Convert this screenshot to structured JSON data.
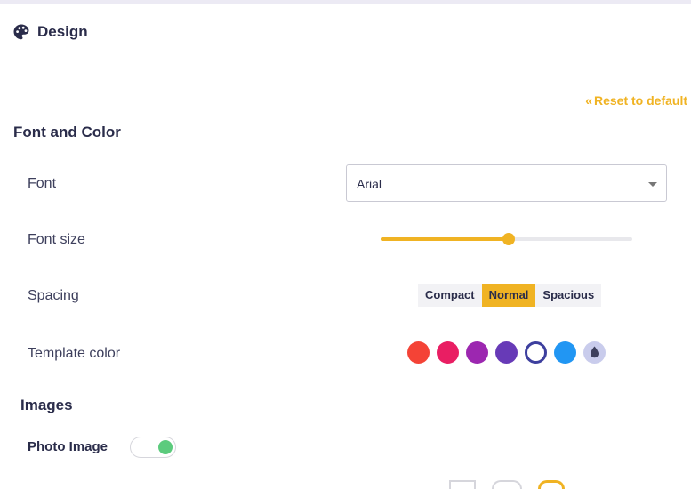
{
  "header": {
    "title": "Design",
    "icon": "palette-icon"
  },
  "reset": {
    "label": "Reset to default",
    "icon": "double-chevron-left-icon",
    "color": "#f0b323"
  },
  "font_and_color": {
    "title": "Font and Color",
    "font": {
      "label": "Font",
      "value": "Arial"
    },
    "font_size": {
      "label": "Font size",
      "value_fraction": 0.51
    },
    "spacing": {
      "label": "Spacing",
      "options": [
        "Compact",
        "Normal",
        "Spacious"
      ],
      "selected": "Normal"
    },
    "template_color": {
      "label": "Template color",
      "colors": [
        "#f44336",
        "#e91e63",
        "#9c27b0",
        "#673ab7",
        "#ffffff",
        "#2196f3"
      ],
      "selected_index": 4,
      "picker_icon": "color-drop-icon"
    }
  },
  "images": {
    "title": "Images",
    "photo_image": {
      "label": "Photo Image",
      "enabled": true,
      "on_color": "#5ccb7d"
    }
  },
  "colors": {
    "accent": "#f0b323",
    "text": "#2a2c4a",
    "selected_ring": "#3d3f9e"
  }
}
